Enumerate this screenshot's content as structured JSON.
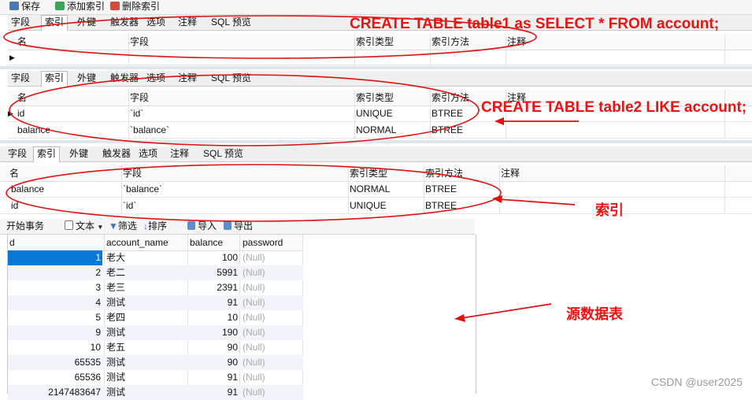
{
  "toolbar": {
    "save": "保存",
    "add_index": "添加索引",
    "delete_index": "删除索引"
  },
  "tabs": [
    "字段",
    "索引",
    "外键",
    "触发器",
    "选项",
    "注释",
    "SQL 预览"
  ],
  "index_columns": [
    "名",
    "字段",
    "索引类型",
    "索引方法",
    "注释"
  ],
  "panel2_rows": [
    {
      "name": "id",
      "field": "`id`",
      "type": "UNIQUE",
      "method": "BTREE"
    },
    {
      "name": "balance",
      "field": "`balance`",
      "type": "NORMAL",
      "method": "BTREE"
    }
  ],
  "panel3_rows": [
    {
      "name": "balance",
      "field": "`balance`",
      "type": "NORMAL",
      "method": "BTREE"
    },
    {
      "name": "id",
      "field": "`id`",
      "type": "UNIQUE",
      "method": "BTREE"
    }
  ],
  "data_toolbar": {
    "begin": "开始事务",
    "text": "文本",
    "filter": "筛选",
    "sort": "排序",
    "import": "导入",
    "export": "导出"
  },
  "data_columns": [
    "d",
    "account_name",
    "balance",
    "password"
  ],
  "data_rows": [
    {
      "id": "1",
      "name": "老大",
      "balance": "100",
      "password": "(Null)"
    },
    {
      "id": "2",
      "name": "老二",
      "balance": "5991",
      "password": "(Null)"
    },
    {
      "id": "3",
      "name": "老三",
      "balance": "2391",
      "password": "(Null)"
    },
    {
      "id": "4",
      "name": "测试",
      "balance": "91",
      "password": "(Null)"
    },
    {
      "id": "5",
      "name": "老四",
      "balance": "10",
      "password": "(Null)"
    },
    {
      "id": "9",
      "name": "测试",
      "balance": "190",
      "password": "(Null)"
    },
    {
      "id": "10",
      "name": "老五",
      "balance": "90",
      "password": "(Null)"
    },
    {
      "id": "65535",
      "name": "测试",
      "balance": "90",
      "password": "(Null)"
    },
    {
      "id": "65536",
      "name": "测试",
      "balance": "91",
      "password": "(Null)"
    },
    {
      "id": "2147483647",
      "name": "测试",
      "balance": "91",
      "password": "(Null)"
    }
  ],
  "annotations": {
    "sql1": "CREATE TABLE table1 as SELECT * FROM account;",
    "sql2": "CREATE TABLE table2 LIKE account;",
    "index": "索引",
    "source": "源数据表"
  },
  "watermark": "CSDN @user2025",
  "colors": {
    "annotation": "#e11111",
    "selected": "#0a78d7"
  }
}
